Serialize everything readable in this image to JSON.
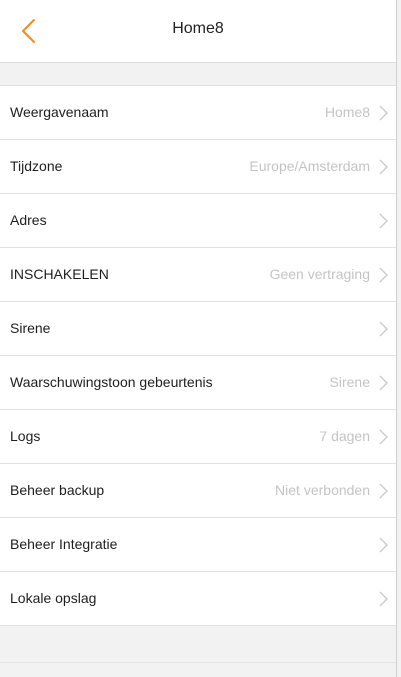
{
  "header": {
    "title": "Home8",
    "back_icon": "chevron-left-icon",
    "accent": "#f08a24"
  },
  "rows": [
    {
      "label": "Weergavenaam",
      "value": "Home8"
    },
    {
      "label": "Tijdzone",
      "value": "Europe/Amsterdam"
    },
    {
      "label": "Adres",
      "value": ""
    },
    {
      "label": "INSCHAKELEN",
      "value": "Geen vertraging"
    },
    {
      "label": "Sirene",
      "value": ""
    },
    {
      "label": "Waarschuwingstoon gebeurtenis",
      "value": "Sirene"
    },
    {
      "label": "Logs",
      "value": "7 dagen"
    },
    {
      "label": "Beheer backup",
      "value": "Niet verbonden"
    },
    {
      "label": "Beheer Integratie",
      "value": ""
    },
    {
      "label": "Lokale opslag",
      "value": ""
    }
  ],
  "row_icon": "chevron-right-icon"
}
